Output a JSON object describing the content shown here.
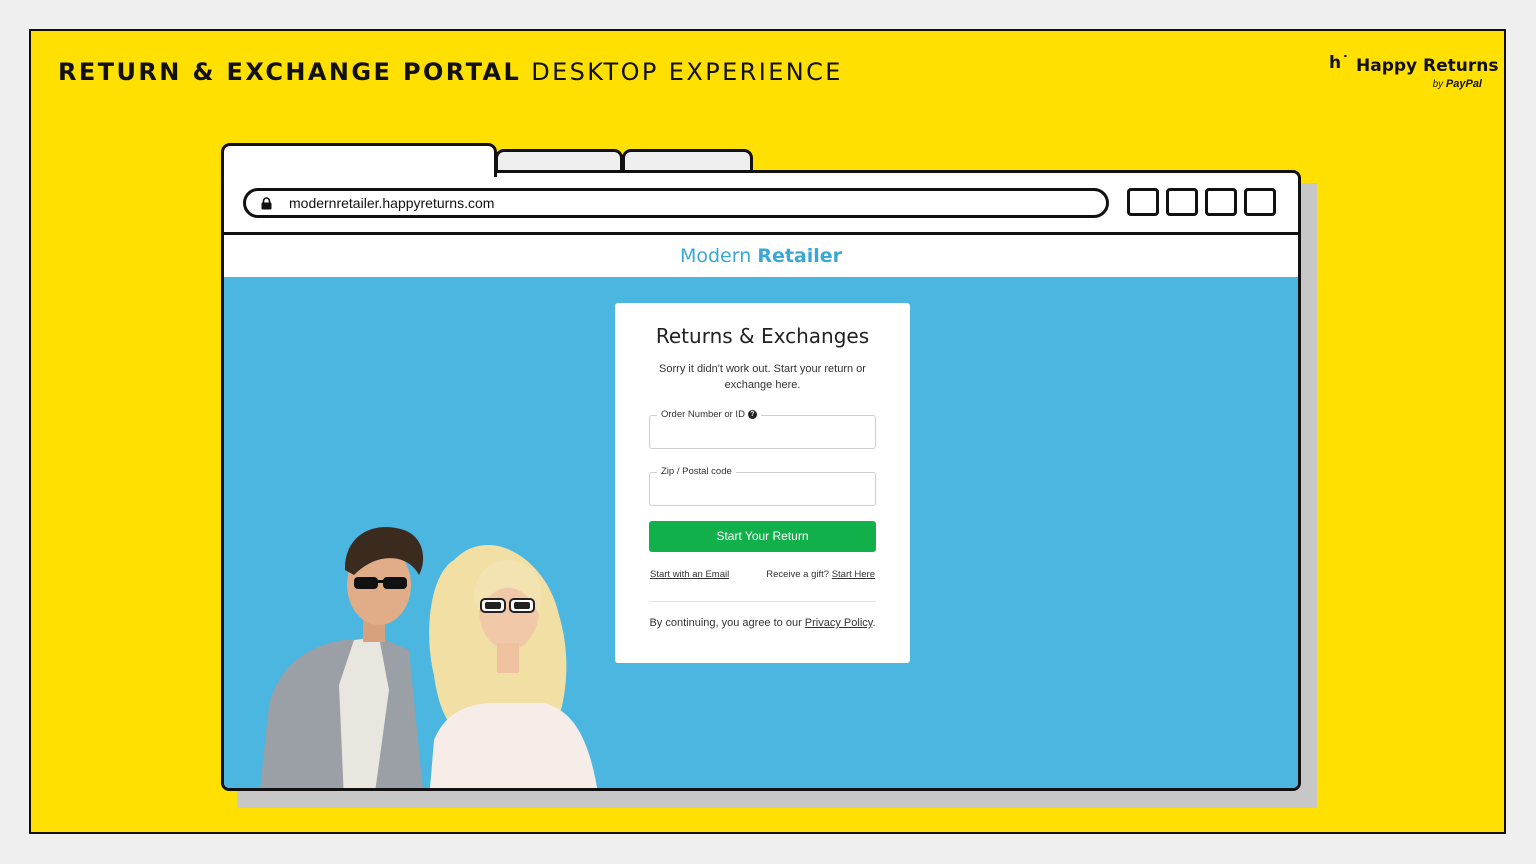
{
  "slide": {
    "heading_bold": "RETURN & EXCHANGE PORTAL",
    "heading_light": "DESKTOP EXPERIENCE",
    "brand": {
      "smile": "h˙",
      "name": "Happy Returns",
      "by": "by",
      "paypal": "PayPal"
    }
  },
  "browser": {
    "url": "modernretailer.happyreturns.com",
    "icons": [
      "lock-icon",
      "window-button-icon"
    ]
  },
  "site": {
    "brand_light": "Modern",
    "brand_bold": "Retailer"
  },
  "portal": {
    "title": "Returns & Exchanges",
    "subtitle": "Sorry it didn't work out. Start your return or exchange here.",
    "order_label": "Order Number or ID",
    "help_icon": "?",
    "zip_label": "Zip / Postal code",
    "order_value": "",
    "zip_value": "",
    "submit": "Start Your Return",
    "email_link": "Start with an Email",
    "gift_text": "Receive a gift?",
    "gift_link": "Start Here",
    "agree_prefix": "By continuing, you agree to our",
    "privacy_link": "Privacy Policy",
    "agree_suffix": "."
  },
  "colors": {
    "slide_bg": "#ffe000",
    "hero_bg": "#4bb6df",
    "brand_blue": "#3aa8d6",
    "button_green": "#12b04b"
  }
}
